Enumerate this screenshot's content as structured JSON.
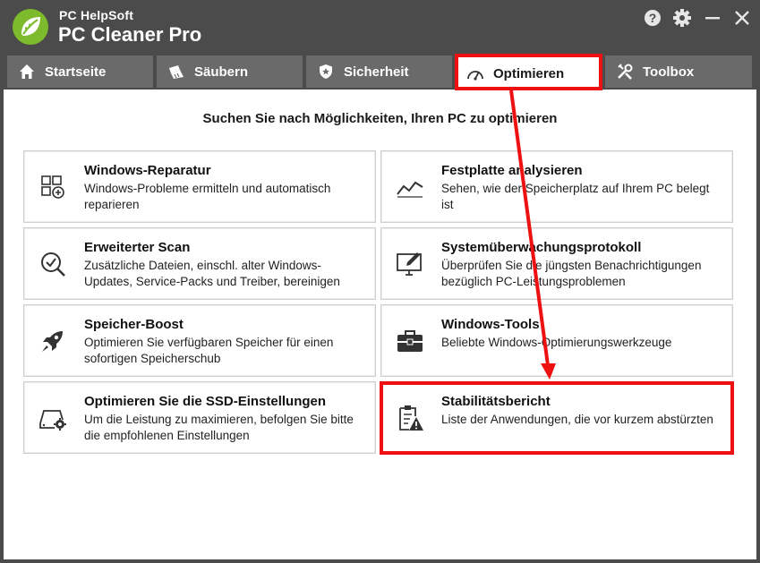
{
  "app": {
    "brand_small": "PC HelpSoft",
    "brand_big": "PC Cleaner Pro",
    "logo_icon": "leaf-logo-icon",
    "window_controls": [
      "help-icon",
      "gear-icon",
      "minimize-icon",
      "close-icon"
    ]
  },
  "tabs": [
    {
      "label": "Startseite",
      "icon": "home-icon"
    },
    {
      "label": "Säubern",
      "icon": "broom-icon"
    },
    {
      "label": "Sicherheit",
      "icon": "shield-icon"
    },
    {
      "label": "Optimieren",
      "icon": "gauge-icon",
      "active": true
    },
    {
      "label": "Toolbox",
      "icon": "tools-icon"
    }
  ],
  "main": {
    "heading": "Suchen Sie nach Möglichkeiten, Ihren PC zu optimieren",
    "cards": [
      {
        "title": "Windows-Reparatur",
        "desc": "Windows-Probleme ermitteln und automatisch reparieren",
        "icon": "windows-plus-icon"
      },
      {
        "title": "Festplatte analysieren",
        "desc": "Sehen, wie der Speicherplatz auf Ihrem PC belegt ist",
        "icon": "trend-chart-icon"
      },
      {
        "title": "Erweiterter Scan",
        "desc": "Zusätzliche Dateien, einschl. alter Windows-Updates, Service-Packs und Treiber, bereinigen",
        "icon": "magnifier-check-icon"
      },
      {
        "title": "Systemüberwachungsprotokoll",
        "desc": "Überprüfen Sie die jüngsten Benachrichtigungen bezüglich PC-Leistungsproblemen",
        "icon": "monitor-edit-icon"
      },
      {
        "title": "Speicher-Boost",
        "desc": "Optimieren Sie verfügbaren Speicher für einen sofortigen Speicherschub",
        "icon": "rocket-icon"
      },
      {
        "title": "Windows-Tools",
        "desc": "Beliebte Windows-Optimierungswerkzeuge",
        "icon": "toolbox-icon"
      },
      {
        "title": "Optimieren Sie die SSD-Einstellungen",
        "desc": "Um die Leistung zu maximieren, befolgen Sie bitte die empfohlenen Einstellungen",
        "icon": "ssd-gear-icon"
      },
      {
        "title": "Stabilitätsbericht",
        "desc": "Liste der Anwendungen, die vor kurzem abstürzten",
        "icon": "clipboard-warning-icon"
      }
    ]
  },
  "annotation": {
    "color": "#ee1111"
  }
}
